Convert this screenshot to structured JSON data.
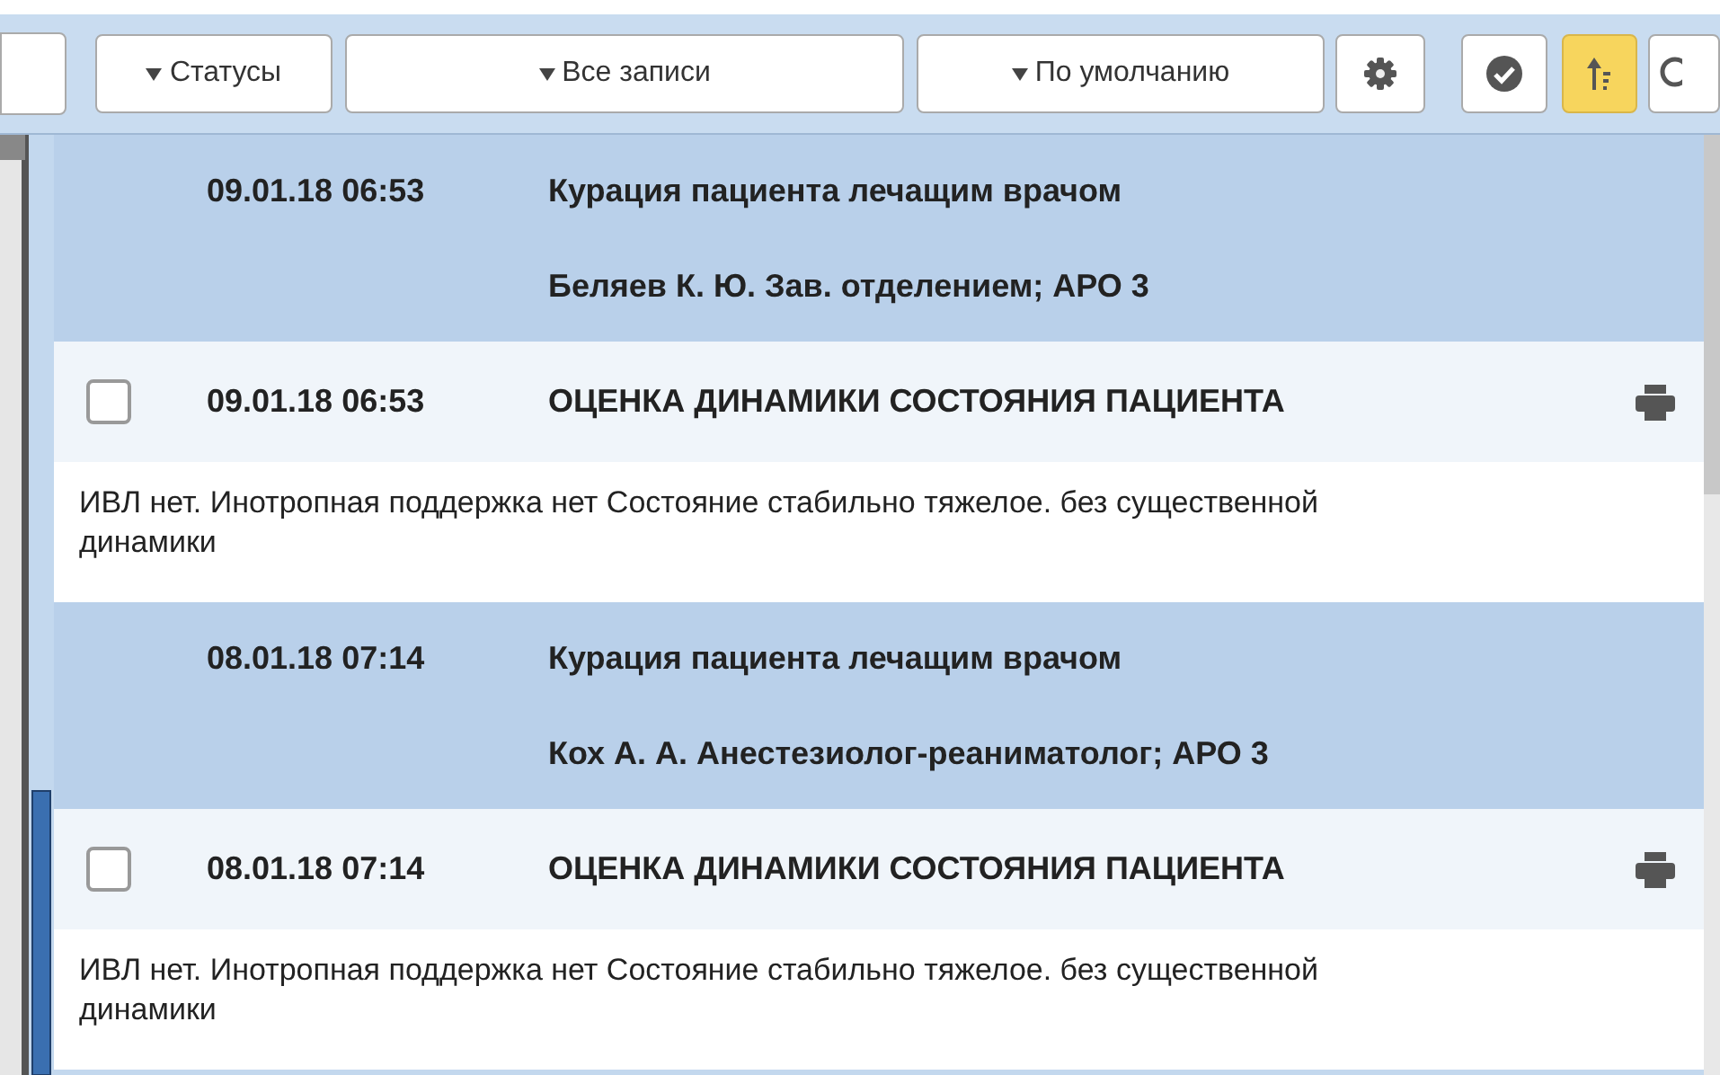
{
  "toolbar": {
    "filters": [
      {
        "label": "Статусы"
      },
      {
        "label": "Все записи"
      },
      {
        "label": "По умолчанию"
      }
    ],
    "icon_buttons": [
      {
        "kind": "settings",
        "selected": false
      },
      {
        "kind": "approve",
        "selected": false
      },
      {
        "kind": "sort",
        "selected": true
      },
      {
        "kind": "search",
        "selected": false
      }
    ]
  },
  "entries": [
    {
      "header": {
        "date": "09.01.18 06:53",
        "title": "Курация пациента лечащим врачом",
        "author": "Беляев К. Ю. Зав. отделением; АРО 3"
      },
      "record": {
        "checked": false,
        "date": "09.01.18 06:53",
        "title": "ОЦЕНКА ДИНАМИКИ СОСТОЯНИЯ ПАЦИЕНТА",
        "text": "ИВЛ нет. Инотропная поддержка нет Состояние стабильно тяжелое. без существенной динамики"
      }
    },
    {
      "header": {
        "date": "08.01.18 07:14",
        "title": "Курация пациента лечащим врачом",
        "author": "Кох А. А. Анестезиолог-реаниматолог; АРО 3"
      },
      "record": {
        "checked": false,
        "date": "08.01.18 07:14",
        "title": "ОЦЕНКА ДИНАМИКИ СОСТОЯНИЯ ПАЦИЕНТА",
        "text": "ИВЛ нет. Инотропная поддержка нет Состояние стабильно тяжелое. без существенной динамики"
      }
    }
  ]
}
